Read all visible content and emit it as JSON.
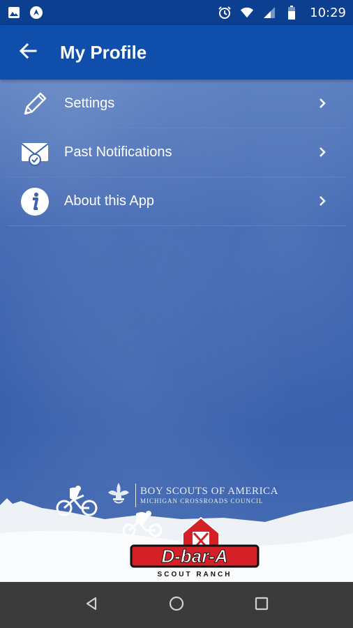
{
  "status_bar": {
    "time": "10:29",
    "left_icons": [
      "image-icon",
      "maps-icon"
    ],
    "right_icons": [
      "alarm-icon",
      "wifi-icon",
      "signal-icon",
      "battery-icon"
    ]
  },
  "app_bar": {
    "title": "My Profile",
    "back_icon": "arrow-left-icon"
  },
  "menu": {
    "items": [
      {
        "label": "Settings",
        "icon": "pencil-icon"
      },
      {
        "label": "Past Notifications",
        "icon": "envelope-icon"
      },
      {
        "label": "About this App",
        "icon": "info-icon"
      }
    ]
  },
  "branding": {
    "org_line1": "BOY SCOUTS OF AMERICA",
    "org_line2": "MICHIGAN CROSSROADS COUNCIL",
    "camp_name": "D-bar-A",
    "camp_sub": "SCOUT RANCH"
  },
  "nav_bar": {
    "buttons": [
      "back-triangle-icon",
      "home-circle-icon",
      "recents-square-icon"
    ]
  },
  "colors": {
    "status_bar": "#0d3f91",
    "app_bar": "#0f4eab",
    "background": "#3a64b0",
    "logo_red": "#d42027",
    "nav_bar": "#3b3b3b"
  }
}
